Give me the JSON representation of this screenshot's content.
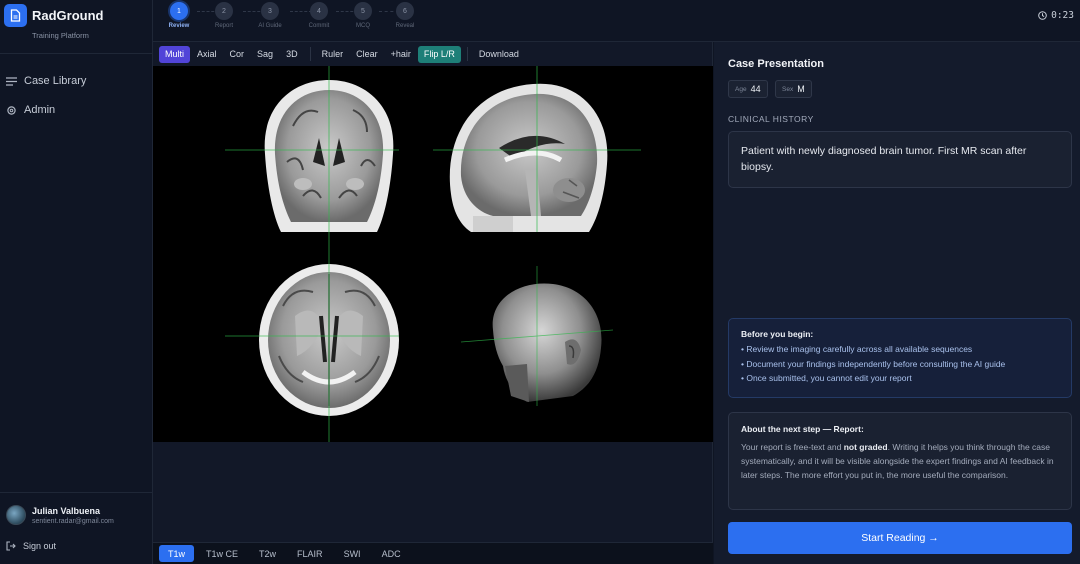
{
  "app": {
    "name": "RadGround",
    "subtitle": "Training Platform"
  },
  "sidebar": {
    "items": [
      {
        "label": "Case Library",
        "icon": "menu-lines-icon"
      },
      {
        "label": "Admin",
        "icon": "gear-icon"
      }
    ],
    "user": {
      "name": "Julian Valbuena",
      "email": "sentient.radar@gmail.com"
    },
    "signout_label": "Sign out"
  },
  "steps": [
    {
      "num": "1",
      "label": "Review",
      "active": true
    },
    {
      "num": "2",
      "label": "Report",
      "active": false
    },
    {
      "num": "3",
      "label": "AI Guide",
      "active": false
    },
    {
      "num": "4",
      "label": "Commit",
      "active": false
    },
    {
      "num": "5",
      "label": "MCQ",
      "active": false
    },
    {
      "num": "6",
      "label": "Reveal",
      "active": false
    }
  ],
  "timer": "0:23",
  "toolbar": {
    "multi": "Multi",
    "axial": "Axial",
    "cor": "Cor",
    "sag": "Sag",
    "three_d": "3D",
    "ruler": "Ruler",
    "clear": "Clear",
    "crosshair": "+hair",
    "flip": "Flip L/R",
    "download": "Download"
  },
  "sequences": [
    "T1w",
    "T1w CE",
    "T2w",
    "FLAIR",
    "SWI",
    "ADC"
  ],
  "active_sequence": "T1w",
  "panel": {
    "title": "Case Presentation",
    "age_key": "Age",
    "age": "44",
    "sex_key": "Sex",
    "sex": "M",
    "history_label": "CLINICAL HISTORY",
    "history": "Patient with newly diagnosed brain tumor. First MR scan after biopsy.",
    "before_title": "Before you begin:",
    "before_items": [
      "• Review the imaging carefully across all available sequences",
      "• Document your findings independently before consulting the AI guide",
      "• Once submitted, you cannot edit your report"
    ],
    "next_title": "About the next step — Report:",
    "next_text_a": "Your report is free-text and ",
    "next_text_bold": "not graded",
    "next_text_b": ". Writing it helps you think through the case systematically, and it will be visible alongside the expert findings and AI feedback in later steps. The more effort you put in, the more useful the comparison.",
    "start_label": "Start Reading →"
  },
  "colors": {
    "accent": "#2c6ff0",
    "flip_active": "#1e7f78",
    "multi_active": "#5144d8",
    "crosshair": "#2fb84a"
  }
}
